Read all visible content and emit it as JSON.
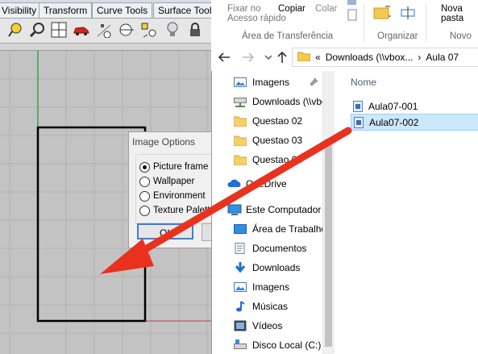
{
  "rhino": {
    "tabs": [
      "Visibility",
      "Transform",
      "Curve Tools",
      "Surface Tool"
    ],
    "toolbar_icons": [
      "lasso-icon",
      "zoom-icon",
      "viewports-icon",
      "car-icon",
      "dots-icon",
      "circle-icon",
      "shapes-icon",
      "bulb-icon",
      "lock-icon"
    ]
  },
  "image_options": {
    "title": "Image Options",
    "options": [
      "Picture frame",
      "Wallpaper",
      "Environment",
      "Texture Palette"
    ],
    "selected": "Picture frame",
    "ok_label": "OK"
  },
  "explorer": {
    "ribbon": {
      "pin_label_1": "Fixar no",
      "pin_label_2": "Acesso rápido",
      "copy_label": "Copiar",
      "paste_label": "Colar",
      "clipboard_group": "Área de Transferência",
      "organize_group": "Organizar",
      "new_folder_1": "Nova",
      "new_folder_2": "pasta",
      "new_group": "Novo"
    },
    "address": {
      "prefix": "«",
      "segment_1": "Downloads (\\\\vbox...",
      "separator": "›",
      "segment_2": "Aula 07"
    },
    "nav_items": [
      {
        "label": "Imagens",
        "icon": "pictures-icon"
      },
      {
        "label": "Downloads (\\\\vbo",
        "icon": "network-drive-icon"
      },
      {
        "label": "Questao 02",
        "icon": "folder-icon"
      },
      {
        "label": "Questao 03",
        "icon": "folder-icon"
      },
      {
        "label": "Questao 04",
        "icon": "folder-icon"
      },
      {
        "label": "OneDrive",
        "icon": "onedrive-icon"
      },
      {
        "label": "Este Computador",
        "icon": "computer-icon"
      },
      {
        "label": "Área de Trabalho",
        "icon": "desktop-icon"
      },
      {
        "label": "Documentos",
        "icon": "documents-icon"
      },
      {
        "label": "Downloads",
        "icon": "downloads-icon"
      },
      {
        "label": "Imagens",
        "icon": "pictures-icon"
      },
      {
        "label": "Músicas",
        "icon": "music-icon"
      },
      {
        "label": "Vídeos",
        "icon": "videos-icon"
      },
      {
        "label": "Disco Local (C:)",
        "icon": "local-disk-icon"
      }
    ],
    "column_header": "Nome",
    "files": [
      {
        "name": "Aula07-001",
        "selected": false
      },
      {
        "name": "Aula07-002",
        "selected": true
      }
    ]
  },
  "colors": {
    "arrow": "#e8321e",
    "selection": "#cce8ff",
    "accent": "#3c7fd5"
  }
}
